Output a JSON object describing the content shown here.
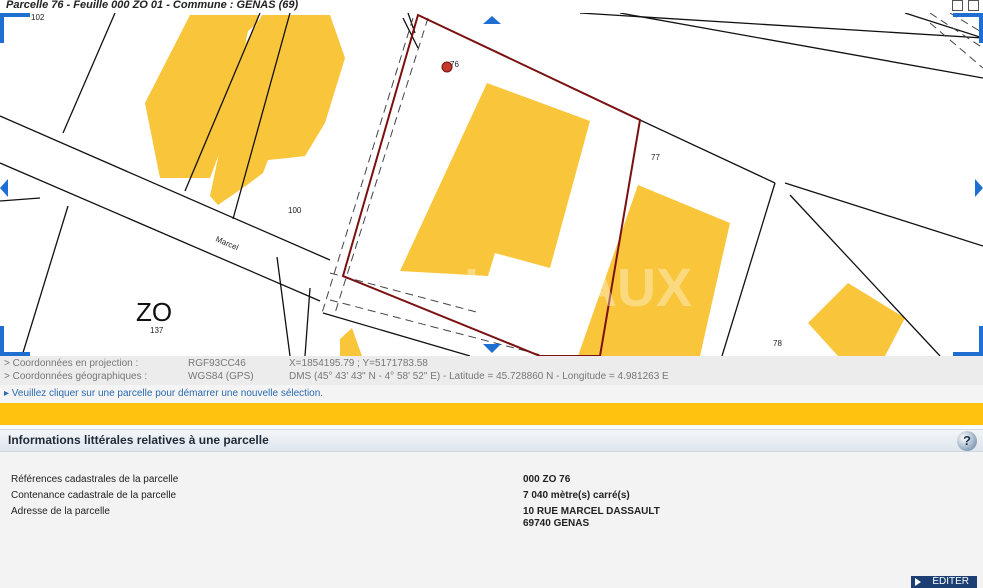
{
  "window": {
    "title": "Parcelle 76 - Feuille 000 ZO 01 - Commune : GENAS (69)"
  },
  "map": {
    "section_label": "ZO",
    "street_label": "Marcel",
    "parcel_numbers": [
      "102",
      "100",
      "137",
      "76",
      "77",
      "78"
    ],
    "watermark": "LOCAUX ENTREPRISE"
  },
  "coordinates": {
    "projection": {
      "label": "> Coordonnées en projection :",
      "system": "RGF93CC46",
      "value": "X=1854195.79 ; Y=5171783.58"
    },
    "geographic": {
      "label": "> Coordonnées géographiques :",
      "system": "WGS84 (GPS)",
      "value": "DMS (45° 43' 43\" N - 4° 58' 52\" E) - Latitude = 45.728860 N - Longitude = 4.981263 E"
    }
  },
  "hint": "▸ Veuillez cliquer sur une parcelle pour démarrer une nouvelle sélection.",
  "info": {
    "header": "Informations littérales relatives à une parcelle",
    "help_label": "?",
    "rows": [
      {
        "label": "Références cadastrales de la parcelle",
        "value": "000 ZO 76"
      },
      {
        "label": "Contenance cadastrale de la parcelle",
        "value": "7 040 mètre(s) carré(s)"
      },
      {
        "label": "Adresse de la parcelle",
        "value": "10 RUE MARCEL DASSAULT",
        "value2": "69740 GENAS"
      }
    ]
  },
  "footer": {
    "edit_label": "ÉDITER"
  },
  "colors": {
    "building": "#f9c53a",
    "selected_parcel": "#7a1010",
    "banner": "#ffc20e",
    "nav_arrow": "#1e6fd1",
    "edit_button": "#1b3f72"
  }
}
